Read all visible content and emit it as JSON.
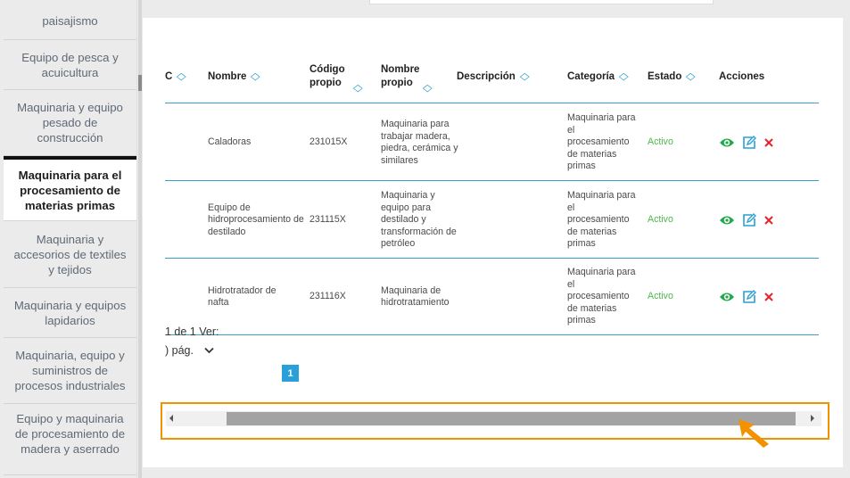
{
  "sidebar": {
    "items": [
      {
        "label": "paisajismo",
        "active": false
      },
      {
        "label": "Equipo de pesca y acuicultura",
        "active": false
      },
      {
        "label": "Maquinaria y equipo pesado de construcción",
        "active": false
      },
      {
        "label": "Maquinaria para el procesamiento de materias primas",
        "active": true
      },
      {
        "label": "Maquinaria y accesorios de textiles y tejidos",
        "active": false
      },
      {
        "label": "Maquinaria y equipos lapidarios",
        "active": false
      },
      {
        "label": "Maquinaria, equipo y suministros de procesos industriales",
        "active": false
      },
      {
        "label": "Equipo y maquinaria de procesamiento de madera y aserrado",
        "active": false
      }
    ]
  },
  "table": {
    "headers": {
      "clipped": "C",
      "nombre": "Nombre",
      "codigo": "Código propio",
      "nombre_propio": "Nombre propio",
      "descripcion": "Descripción",
      "categoria": "Categoría",
      "estado": "Estado",
      "acciones": "Acciones"
    },
    "rows": [
      {
        "nombre": "Caladoras",
        "codigo": "231015X",
        "nombre_propio": "Maquinaria para trabajar madera, piedra, cerámica y similares",
        "descripcion": "",
        "categoria": "Maquinaria para el procesamiento de materias primas",
        "estado": "Activo"
      },
      {
        "nombre": "Equipo de hidroprocesamiento de destilado",
        "codigo": "231115X",
        "nombre_propio": "Maquinaria y equipo para destilado y transformación de petróleo",
        "descripcion": "",
        "categoria": "Maquinaria para el procesamiento de materias primas",
        "estado": "Activo"
      },
      {
        "nombre": "Hidrotratador de nafta",
        "codigo": "231116X",
        "nombre_propio": "Maquinaria de hidrotratamiento",
        "descripcion": "",
        "categoria": "Maquinaria para el procesamiento de materias primas",
        "estado": "Activo"
      }
    ]
  },
  "pager": {
    "info": "1 de 1 Ver:",
    "per_page": ") pág.",
    "current_page": "1"
  },
  "icons": {
    "view": "eye-icon",
    "edit": "edit-icon",
    "delete": "close-icon",
    "sort": "sort-icon",
    "cursor": "cursor-arrow-icon"
  },
  "colors": {
    "accent": "#2aa0d8",
    "active_status": "#4cb84c",
    "delete": "#e8212a",
    "highlight": "#f39200"
  }
}
